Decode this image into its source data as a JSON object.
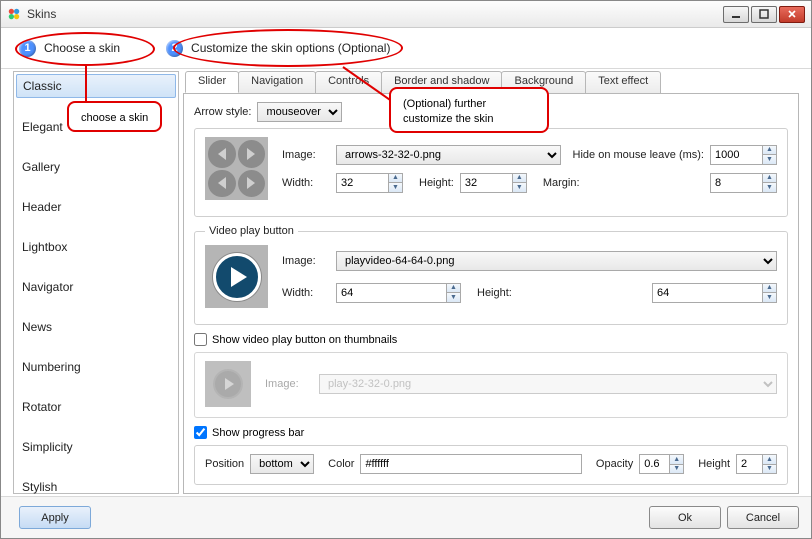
{
  "window": {
    "title": "Skins"
  },
  "steps": {
    "step1_num": "1",
    "step1_text": "Choose a skin",
    "step2_num": "2",
    "step2_text": "Customize the skin options (Optional)"
  },
  "annotations": {
    "choose_box": "choose a skin",
    "customize_box": "(Optional) further customize the skin"
  },
  "skins": {
    "items": [
      "Classic",
      "Elegant",
      "Gallery",
      "Header",
      "Lightbox",
      "Navigator",
      "News",
      "Numbering",
      "Rotator",
      "Simplicity",
      "Stylish"
    ],
    "selected": "Classic"
  },
  "tabs": [
    "Slider",
    "Navigation",
    "Controls",
    "Border and shadow",
    "Background",
    "Text effect"
  ],
  "tabs_active": "Slider",
  "slider": {
    "arrow_style_label": "Arrow style:",
    "arrow_style_value": "mouseover",
    "arrows": {
      "image_label": "Image:",
      "image_value": "arrows-32-32-0.png",
      "hide_label": "Hide on mouse leave (ms):",
      "hide_value": "1000",
      "width_label": "Width:",
      "width_value": "32",
      "height_label": "Height:",
      "height_value": "32",
      "margin_label": "Margin:",
      "margin_value": "8"
    },
    "video": {
      "legend": "Video play button",
      "image_label": "Image:",
      "image_value": "playvideo-64-64-0.png",
      "width_label": "Width:",
      "width_value": "64",
      "height_label": "Height:",
      "height_value": "64"
    },
    "thumb_video": {
      "check_label": "Show video play button on thumbnails",
      "checked": false,
      "image_label": "Image:",
      "image_value": "play-32-32-0.png"
    },
    "progress": {
      "check_label": "Show progress bar",
      "checked": true,
      "position_label": "Position",
      "position_value": "bottom",
      "color_label": "Color",
      "color_value": "#ffffff",
      "opacity_label": "Opacity",
      "opacity_value": "0.6",
      "height_label": "Height",
      "height_value": "2"
    }
  },
  "buttons": {
    "apply": "Apply",
    "ok": "Ok",
    "cancel": "Cancel"
  }
}
